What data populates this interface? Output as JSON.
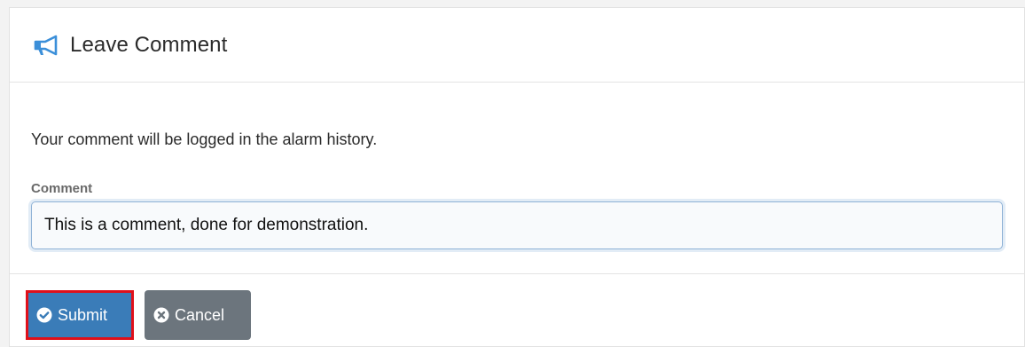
{
  "dialog": {
    "title": "Leave Comment",
    "description": "Your comment will be logged in the alarm history.",
    "comment_label": "Comment",
    "comment_value": "This is a comment, done for demonstration.",
    "submit_label": "Submit",
    "cancel_label": "Cancel",
    "icons": {
      "header": "megaphone-icon",
      "submit": "check-circle-icon",
      "cancel": "times-circle-icon"
    },
    "colors": {
      "accent": "#3a7cb8",
      "cancel": "#6c757d",
      "highlight": "#e0101a"
    }
  }
}
